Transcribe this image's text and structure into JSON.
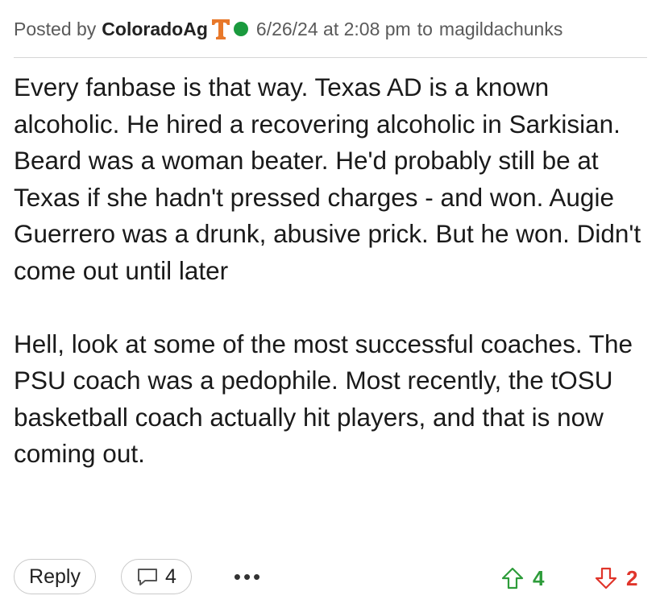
{
  "post": {
    "posted_by_label": "Posted by",
    "author": "ColoradoAg",
    "team_logo_icon": "texas-longhorns-t-icon",
    "team_logo_color": "#e8782a",
    "status_dot_color": "#1a9a3e",
    "timestamp": "6/26/24 at 2:08 pm",
    "to_label": "to",
    "reply_to_user": "magildachunks",
    "paragraphs": [
      "Every fanbase is that way. Texas AD is a known alcoholic. He hired a recovering alcoholic in Sarkisian. Beard was a woman beater. He'd probably still be at Texas if she hadn't pressed charges - and won. Augie Guerrero was a drunk, abusive prick. But he won. Didn't come out until later",
      "Hell, look at some of the most successful coaches. The PSU coach was a pedophile. Most recently, the tOSU basketball coach actually hit players, and that is now coming out."
    ]
  },
  "actions": {
    "reply_label": "Reply",
    "comment_count": "4",
    "comment_icon": "comment-bubble-icon",
    "more_label": "•••",
    "upvote_count": "4",
    "upvote_color": "#2e9c3a",
    "upvote_icon": "arrow-up-outline-icon",
    "downvote_count": "2",
    "downvote_color": "#e0352b",
    "downvote_icon": "arrow-down-outline-icon"
  }
}
